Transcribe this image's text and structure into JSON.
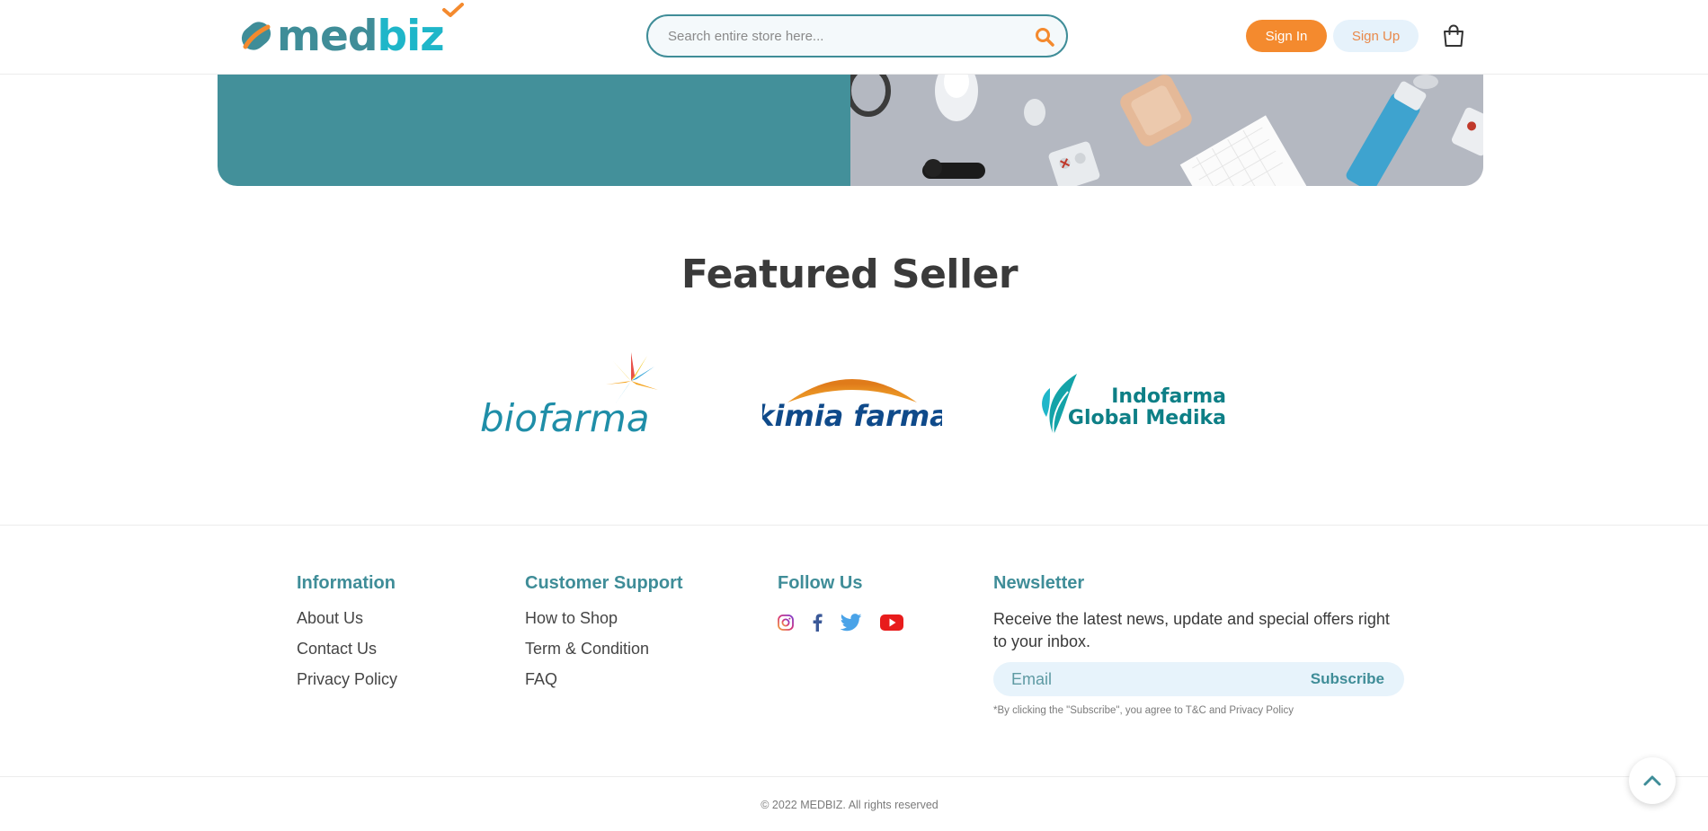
{
  "header": {
    "logo": {
      "text_main": "med",
      "text_accent": "biz"
    },
    "search": {
      "placeholder": "Search entire store here..."
    },
    "sign_in_label": "Sign In",
    "sign_up_label": "Sign Up",
    "icons": {
      "search": "search-icon",
      "cart": "shopping-bag-icon"
    }
  },
  "colors": {
    "brand_teal": "#3f8d98",
    "brand_cyan": "#1fb6c9",
    "accent_orange": "#f48a2e",
    "banner_teal": "#43909a"
  },
  "featured": {
    "title": "Featured Seller",
    "sellers": [
      {
        "logo_text": "biofarma"
      },
      {
        "logo_text": "kimia farma"
      },
      {
        "logo_text_line1": "Indofarma",
        "logo_text_line2": "Global Medika"
      }
    ]
  },
  "footer": {
    "information": {
      "heading": "Information",
      "links": [
        "About Us",
        "Contact Us",
        "Privacy Policy"
      ]
    },
    "support": {
      "heading": "Customer Support",
      "links": [
        "How to Shop",
        "Term & Condition",
        "FAQ"
      ]
    },
    "follow": {
      "heading": "Follow Us",
      "icons": [
        "instagram-icon",
        "facebook-icon",
        "twitter-icon",
        "youtube-icon"
      ]
    },
    "newsletter": {
      "heading": "Newsletter",
      "text": "Receive the latest news, update and special offers right to your inbox.",
      "email_placeholder": "Email",
      "subscribe_label": "Subscribe",
      "note": "*By clicking the \"Subscribe\", you agree to T&C and Privacy Policy"
    },
    "copyright": "© 2022 MEDBIZ. All rights reserved"
  },
  "back_to_top_icon": "chevron-up-icon"
}
